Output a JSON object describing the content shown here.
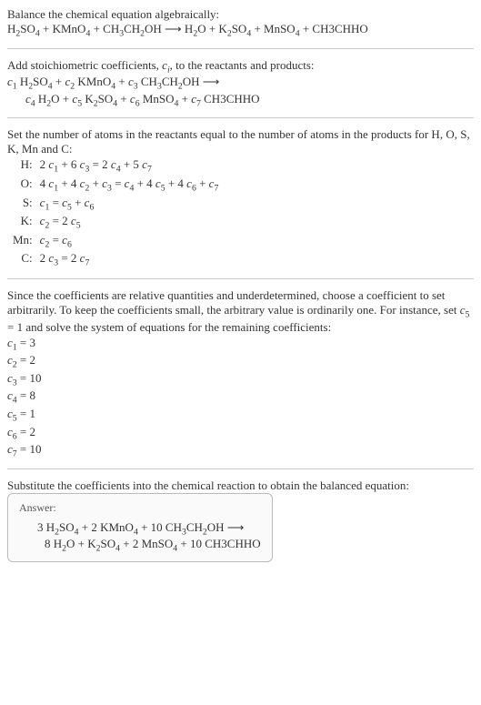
{
  "s1_line1": "Balance the chemical equation algebraically:",
  "s1_eq_a": "H",
  "s1_eq_b": "SO",
  "s1_eq_c": " + KMnO",
  "s1_eq_d": " + CH",
  "s1_eq_e": "CH",
  "s1_eq_f": "OH  ⟶  H",
  "s1_eq_g": "O + K",
  "s1_eq_h": "SO",
  "s1_eq_i": " + MnSO",
  "s1_eq_j": " + CH3CHHO",
  "s2_line1_a": "Add stoichiometric coefficients, ",
  "s2_line1_b": "c",
  "s2_line1_c": "i",
  "s2_line1_d": ", to the reactants and products:",
  "s2_eq_r1_a": "c",
  "s2_eq_r1_b": " H",
  "s2_eq_r1_c": "SO",
  "s2_eq_r1_d": " + ",
  "s2_eq_r1_e": "c",
  "s2_eq_r1_f": " KMnO",
  "s2_eq_r1_g": " + ",
  "s2_eq_r1_h": "c",
  "s2_eq_r1_i": " CH",
  "s2_eq_r1_j": "CH",
  "s2_eq_r1_k": "OH  ⟶",
  "s2_eq_r2_a": "c",
  "s2_eq_r2_b": " H",
  "s2_eq_r2_c": "O + ",
  "s2_eq_r2_d": "c",
  "s2_eq_r2_e": " K",
  "s2_eq_r2_f": "SO",
  "s2_eq_r2_g": " + ",
  "s2_eq_r2_h": "c",
  "s2_eq_r2_i": " MnSO",
  "s2_eq_r2_j": " + ",
  "s2_eq_r2_k": "c",
  "s2_eq_r2_l": " CH3CHHO",
  "s3_line1": "Set the number of atoms in the reactants equal to the number of atoms in the products for H, O, S, K, Mn and C:",
  "rows": [
    {
      "el": "H:",
      "lhs_a": "2 ",
      "c1": "c",
      "s1": "1",
      "mid1": " + 6 ",
      "c2": "c",
      "s2": "3",
      "eq": " = 2 ",
      "c3": "c",
      "s3": "4",
      "mid2": " + 5 ",
      "c4": "c",
      "s4": "7",
      "tail": ""
    },
    {
      "el": "O:",
      "lhs_a": "4 ",
      "c1": "c",
      "s1": "1",
      "mid1": " + 4 ",
      "c2": "c",
      "s2": "2",
      "eq": " + ",
      "c3": "c",
      "s3": "3",
      "mid2": " = ",
      "c4": "c",
      "s4": "4",
      "tail_a": " + 4 ",
      "c5": "c",
      "s5": "5",
      "tail_b": " + 4 ",
      "c6": "c",
      "s6": "6",
      "tail_c": " + ",
      "c7": "c",
      "s7": "7"
    },
    {
      "el": "S:",
      "lhs_a": "",
      "c1": "c",
      "s1": "1",
      "mid1": " = ",
      "c2": "c",
      "s2": "5",
      "eq": " + ",
      "c3": "c",
      "s3": "6",
      "mid2": "",
      "c4": "",
      "s4": "",
      "tail": ""
    },
    {
      "el": "K:",
      "lhs_a": "",
      "c1": "c",
      "s1": "2",
      "mid1": " = 2 ",
      "c2": "c",
      "s2": "5",
      "eq": "",
      "c3": "",
      "s3": "",
      "mid2": "",
      "c4": "",
      "s4": "",
      "tail": ""
    },
    {
      "el": "Mn:",
      "lhs_a": "",
      "c1": "c",
      "s1": "2",
      "mid1": " = ",
      "c2": "c",
      "s2": "6",
      "eq": "",
      "c3": "",
      "s3": "",
      "mid2": "",
      "c4": "",
      "s4": "",
      "tail": ""
    },
    {
      "el": "C:",
      "lhs_a": "2 ",
      "c1": "c",
      "s1": "3",
      "mid1": " = 2 ",
      "c2": "c",
      "s2": "7",
      "eq": "",
      "c3": "",
      "s3": "",
      "mid2": "",
      "c4": "",
      "s4": "",
      "tail": ""
    }
  ],
  "s4_line1_a": "Since the coefficients are relative quantities and underdetermined, choose a coefficient to set arbitrarily. To keep the coefficients small, the arbitrary value is ordinarily one. For instance, set ",
  "s4_line1_b": "c",
  "s4_line1_c": " = 1 and solve the system of equations for the remaining coefficients:",
  "coeffs": [
    {
      "c": "c",
      "i": "1",
      "v": " = 3"
    },
    {
      "c": "c",
      "i": "2",
      "v": " = 2"
    },
    {
      "c": "c",
      "i": "3",
      "v": " = 10"
    },
    {
      "c": "c",
      "i": "4",
      "v": " = 8"
    },
    {
      "c": "c",
      "i": "5",
      "v": " = 1"
    },
    {
      "c": "c",
      "i": "6",
      "v": " = 2"
    },
    {
      "c": "c",
      "i": "7",
      "v": " = 10"
    }
  ],
  "s5_line1": "Substitute the coefficients into the chemical reaction to obtain the balanced equation:",
  "ans_label": "Answer:",
  "ans_r1_a": "3 H",
  "ans_r1_b": "SO",
  "ans_r1_c": " + 2 KMnO",
  "ans_r1_d": " + 10 CH",
  "ans_r1_e": "CH",
  "ans_r1_f": "OH  ⟶",
  "ans_r2_a": "8 H",
  "ans_r2_b": "O + K",
  "ans_r2_c": "SO",
  "ans_r2_d": " + 2 MnSO",
  "ans_r2_e": " + 10 CH3CHHO",
  "n2": "2",
  "n3": "3",
  "n4": "4",
  "n5": "5",
  "n6": "6",
  "n7": "7",
  "n1": "1"
}
